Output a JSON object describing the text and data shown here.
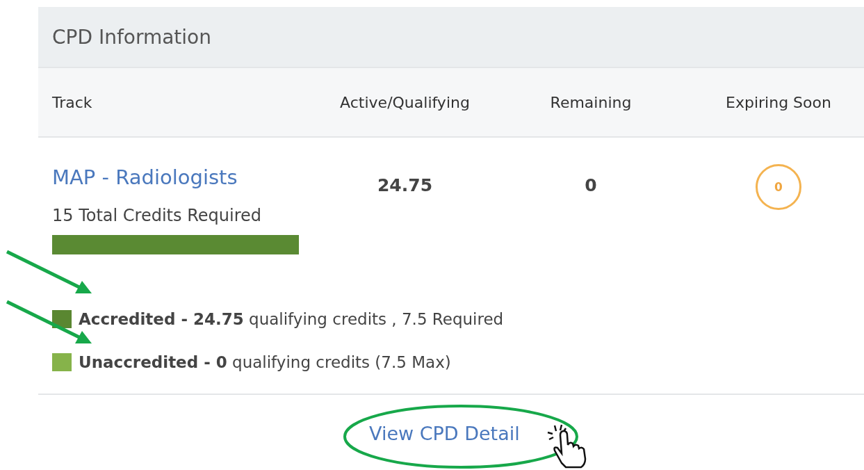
{
  "panel": {
    "title": "CPD Information"
  },
  "columns": [
    "Track",
    "Active/Qualifying",
    "Remaining",
    "Expiring Soon"
  ],
  "track": {
    "name": "MAP - Radiologists",
    "required": "15 Total Credits Required",
    "active": "24.75",
    "remaining": "0",
    "expiring": "0"
  },
  "legend": [
    {
      "text": "**Accredited - 24.75** qualifying credits , 7.5 Required",
      "color": "#5a8731"
    },
    {
      "text": "**Unaccredited - 0** qualifying credits (7.5 Max)",
      "color": "#86b34a"
    }
  ],
  "detail_link": "View CPD Detail"
}
